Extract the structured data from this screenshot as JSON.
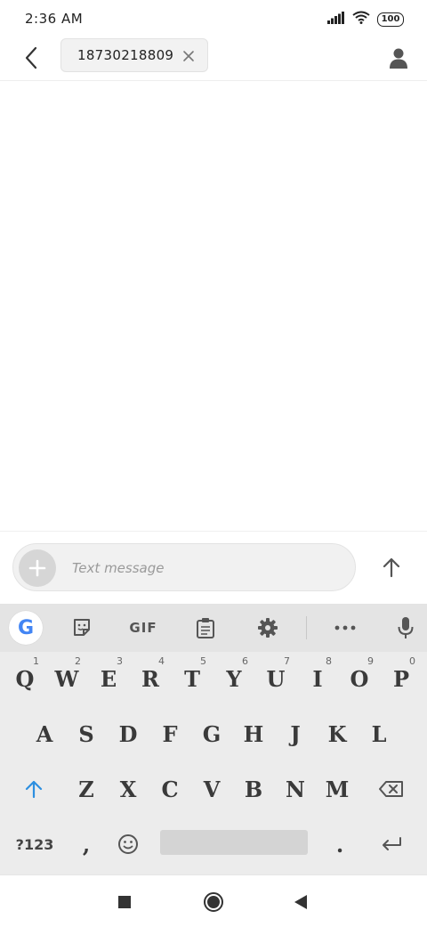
{
  "status": {
    "time": "2:36 AM",
    "battery": "100"
  },
  "header": {
    "recipient": "18730218809"
  },
  "composer": {
    "placeholder": "Text message"
  },
  "keyboard": {
    "toolbar": {
      "google": "G",
      "gif": "GIF"
    },
    "row1": [
      {
        "label": "Q",
        "hint": "1"
      },
      {
        "label": "W",
        "hint": "2"
      },
      {
        "label": "E",
        "hint": "3"
      },
      {
        "label": "R",
        "hint": "4"
      },
      {
        "label": "T",
        "hint": "5"
      },
      {
        "label": "Y",
        "hint": "6"
      },
      {
        "label": "U",
        "hint": "7"
      },
      {
        "label": "I",
        "hint": "8"
      },
      {
        "label": "O",
        "hint": "9"
      },
      {
        "label": "P",
        "hint": "0"
      }
    ],
    "row2": [
      "A",
      "S",
      "D",
      "F",
      "G",
      "H",
      "J",
      "K",
      "L"
    ],
    "row3": [
      "Z",
      "X",
      "C",
      "V",
      "B",
      "N",
      "M"
    ],
    "row4": {
      "symbols": "?123",
      "comma": ",",
      "period": "."
    }
  }
}
